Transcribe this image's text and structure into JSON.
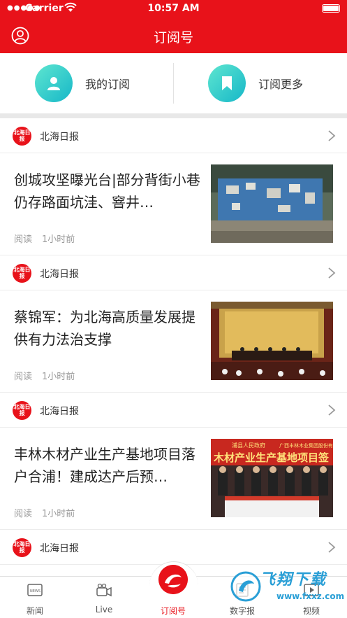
{
  "status_bar": {
    "carrier": "Carrier",
    "time": "10:57 AM"
  },
  "header": {
    "title": "订阅号",
    "user_icon": "user-circle-icon"
  },
  "subscriptions": {
    "mine_label": "我的订阅",
    "more_label": "订阅更多"
  },
  "feed": [
    {
      "source": {
        "name": "北海日报",
        "logo_text": "北海日报"
      },
      "article": {
        "headline": "创城攻坚曝光台|部分背街小巷仍存路面坑洼、窨井…",
        "reads": "阅读",
        "time": "1小时前"
      }
    },
    {
      "source": {
        "name": "北海日报",
        "logo_text": "北海日报"
      },
      "article": {
        "headline": "蔡锦军：为北海高质量发展提供有力法治支撑",
        "reads": "阅读",
        "time": "1小时前"
      }
    },
    {
      "source": {
        "name": "北海日报",
        "logo_text": "北海日报"
      },
      "article": {
        "headline": "丰林木材产业生产基地项目落户合浦！建成达产后预…",
        "reads": "阅读",
        "time": "1小时前",
        "image_banner_left": "浦县人民政府",
        "image_banner_right": "广西丰林木业集团股份有",
        "image_banner_main": "木材产业生产基地项目签"
      }
    },
    {
      "source": {
        "name": "北海日报",
        "logo_text": "北海日报"
      }
    }
  ],
  "tabbar": [
    {
      "label": "新闻",
      "icon": "news-icon"
    },
    {
      "label": "Live",
      "icon": "video-camera-icon"
    },
    {
      "label": "订阅号",
      "icon": "beihai-logo-icon",
      "active": true
    },
    {
      "label": "数字报",
      "icon": "digital-paper-icon"
    },
    {
      "label": "视频",
      "icon": "video-icon"
    }
  ],
  "watermark": {
    "title": "飞翔下载",
    "url": "www.fxxz.com"
  },
  "colors": {
    "brand_red": "#e8121a",
    "teal": "#1fbfc9",
    "text_gray": "#999999"
  }
}
